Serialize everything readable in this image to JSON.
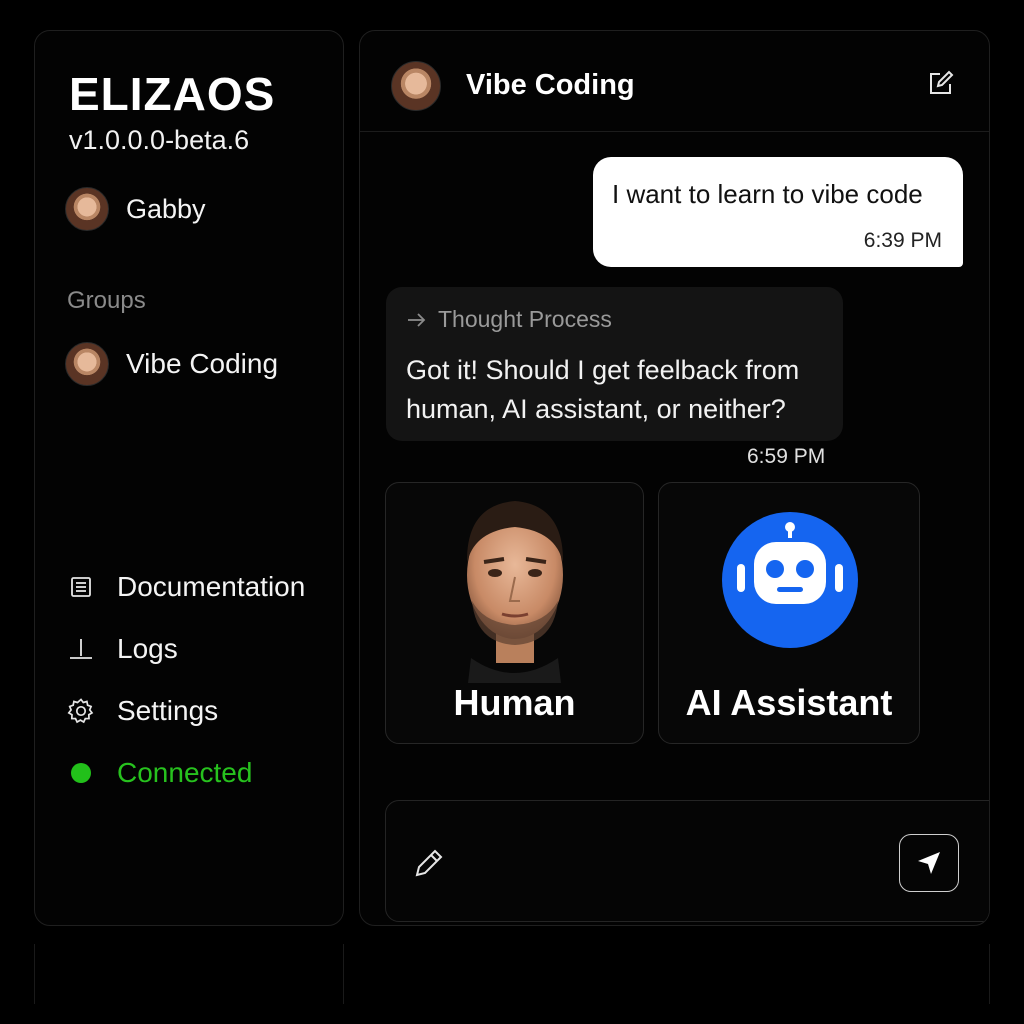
{
  "sidebar": {
    "brand": "ELIZAOS",
    "version": "v1.0.0.0-beta.6",
    "user": {
      "name": "Gabby",
      "avatar_icon": "avatar-woman"
    },
    "groups_heading": "Groups",
    "groups": [
      {
        "label": "Vibe Coding",
        "avatar_icon": "avatar-woman"
      }
    ],
    "nav": [
      {
        "label": "Documentation",
        "icon": "document-icon"
      },
      {
        "label": "Logs",
        "icon": "logs-icon"
      },
      {
        "label": "Settings",
        "icon": "gear-icon"
      },
      {
        "label": "Connected",
        "icon": "status-dot-icon",
        "color": "#27c21e"
      }
    ]
  },
  "chat": {
    "title": "Vibe Coding",
    "messages": [
      {
        "role": "user",
        "text": "I want to learn to vibe code",
        "time": "6:39 PM"
      },
      {
        "role": "agent",
        "thought_label": "Thought Process",
        "text": "Got it! Should I get feelback from human, AI assistant, or neither?",
        "time": "6:59 PM"
      }
    ],
    "options": [
      {
        "label": "Human",
        "icon": "human-portrait"
      },
      {
        "label": "AI Assistant",
        "icon": "robot-icon"
      }
    ]
  },
  "colors": {
    "accent_green": "#27c21e",
    "robot_blue": "#1565f0",
    "background": "#000000"
  }
}
